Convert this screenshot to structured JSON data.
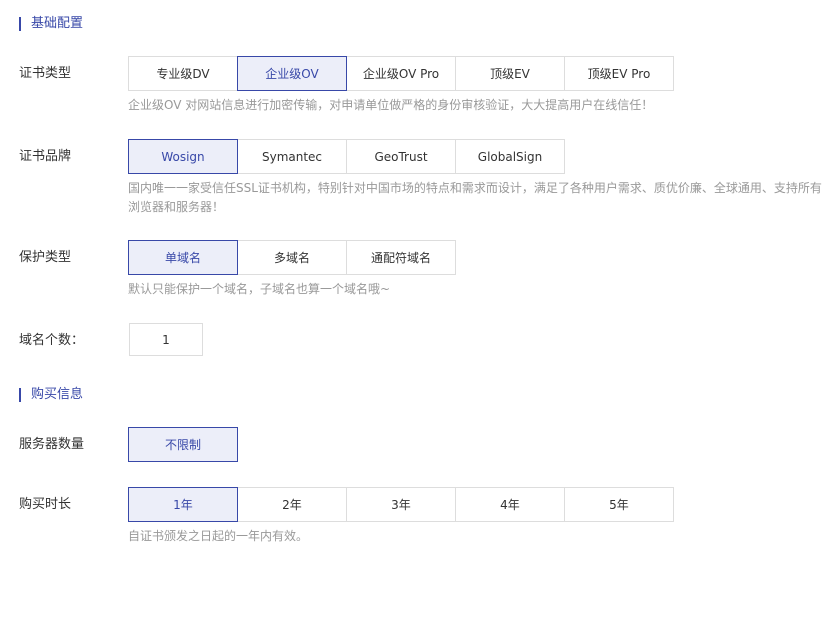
{
  "basic_section": {
    "title": "基础配置"
  },
  "cert_type": {
    "label": "证书类型",
    "options": [
      "专业级DV",
      "企业级OV",
      "企业级OV Pro",
      "顶级EV",
      "顶级EV Pro"
    ],
    "selected": "企业级OV",
    "hint": "企业级OV 对网站信息进行加密传输，对申请单位做严格的身份审核验证，大大提高用户在线信任！"
  },
  "cert_brand": {
    "label": "证书品牌",
    "options": [
      "Wosign",
      "Symantec",
      "GeoTrust",
      "GlobalSign"
    ],
    "selected": "Wosign",
    "hint_line1": "国内唯一一家受信任SSL证书机构，特别针对中国市场的特点和需求而设计，满足了各种用户需求、质优价廉、全球通用、支持所有",
    "hint_line2": "浏览器和服务器！"
  },
  "protect_type": {
    "label": "保护类型",
    "options": [
      "单域名",
      "多域名",
      "通配符域名"
    ],
    "selected": "单域名",
    "hint": "默认只能保护一个域名，子域名也算一个域名哦~"
  },
  "domain_count": {
    "label": "域名个数：",
    "value": "1"
  },
  "purchase_section": {
    "title": "购买信息"
  },
  "server_count": {
    "label": "服务器数量",
    "options": [
      "不限制"
    ],
    "selected": "不限制"
  },
  "duration": {
    "label": "购买时长",
    "options": [
      "1年",
      "2年",
      "3年",
      "4年",
      "5年"
    ],
    "selected": "1年",
    "hint": "自证书颁发之日起的一年内有效。"
  },
  "colors": {
    "accent": "#3848a8",
    "selected_bg": "#eceef9",
    "border": "#dddddd",
    "hint": "#999999"
  }
}
